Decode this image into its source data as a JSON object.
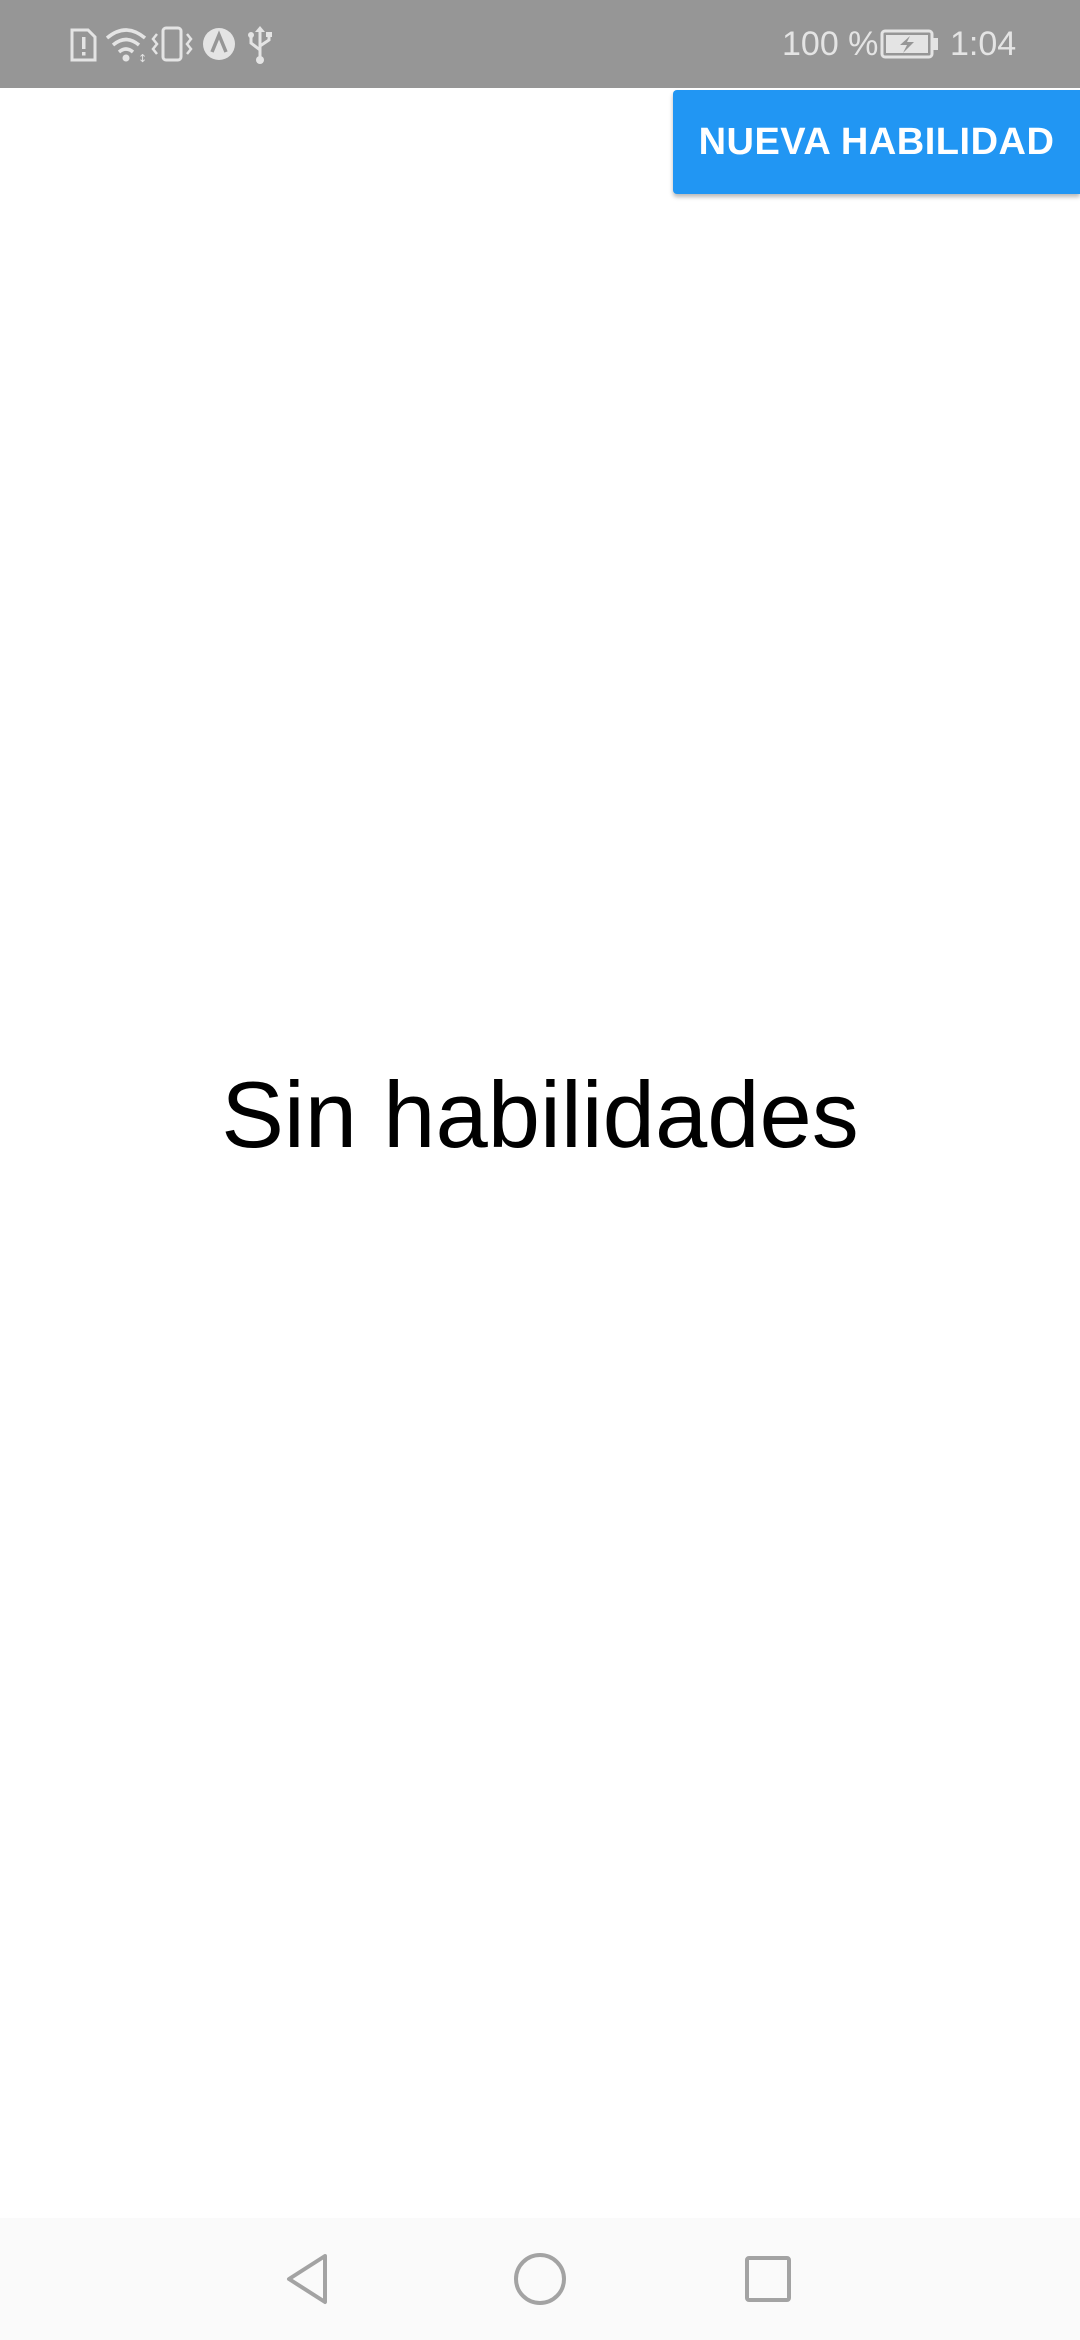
{
  "status_bar": {
    "battery_percent": "100 %",
    "time": "1:04",
    "icons": [
      "sim-alert-icon",
      "wifi-icon",
      "vibrate-icon",
      "app-notification-icon",
      "usb-icon",
      "battery-charging-icon"
    ]
  },
  "actions": {
    "new_skill_label": "NUEVA HABILIDAD"
  },
  "main": {
    "empty_message": "Sin habilidades"
  },
  "navigation": {
    "buttons": [
      "back-icon",
      "home-icon",
      "recents-icon"
    ]
  },
  "colors": {
    "status_bar": "#969696",
    "accent_button": "#2196f3",
    "background": "#ffffff",
    "nav_bar": "#fafafa"
  }
}
